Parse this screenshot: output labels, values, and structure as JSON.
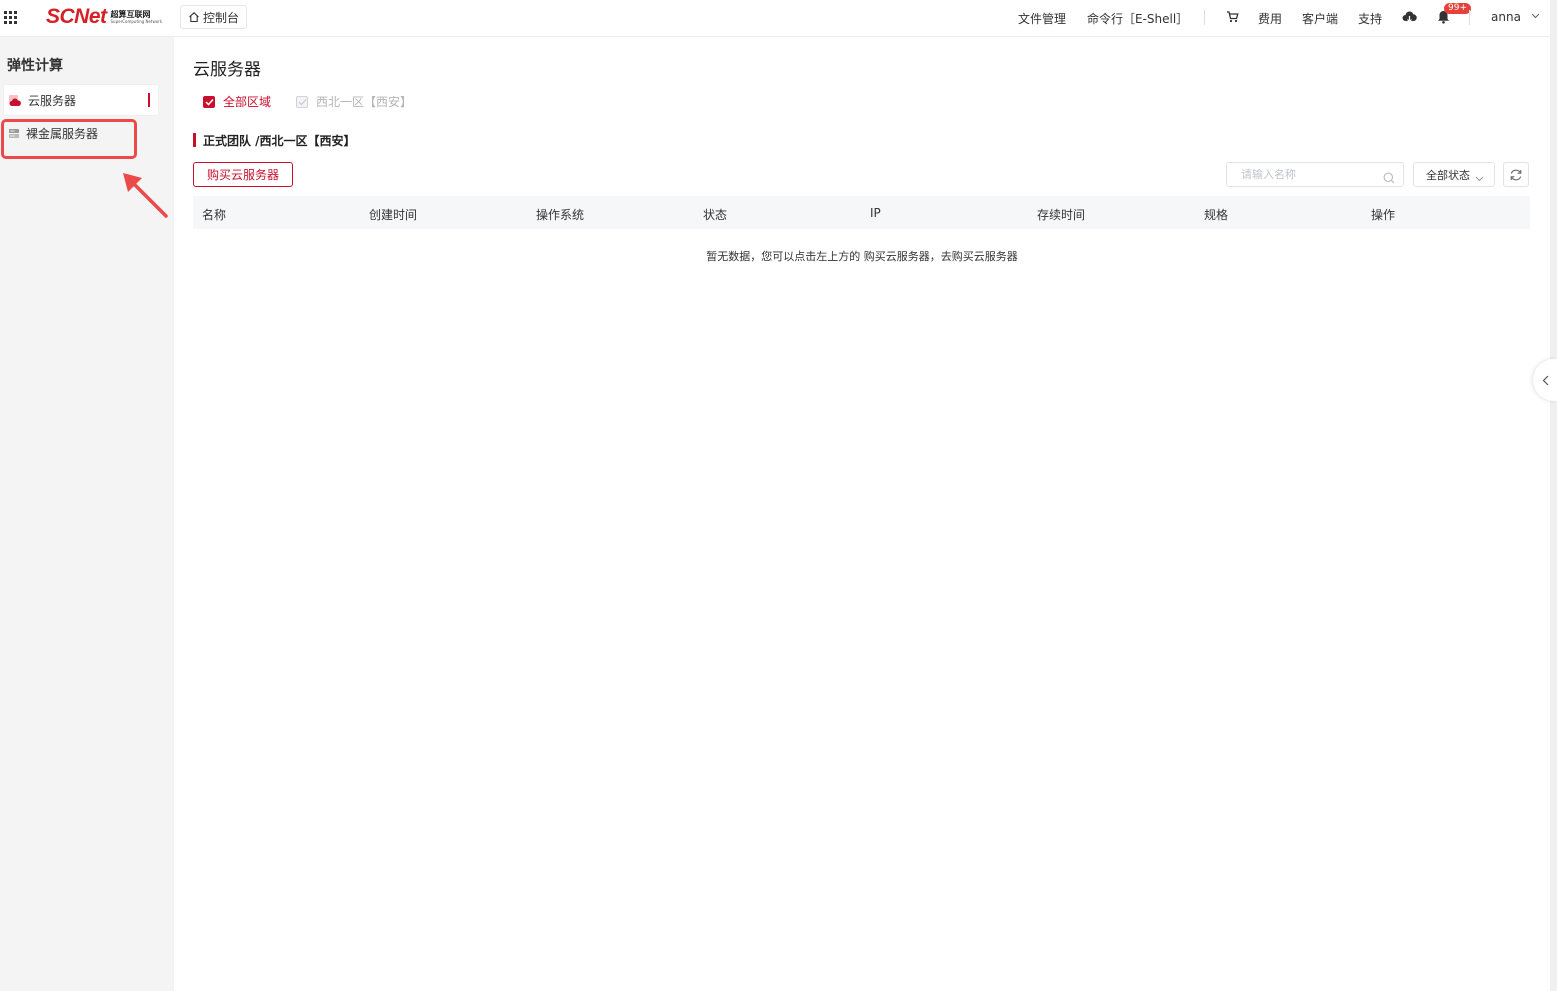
{
  "header": {
    "logo_main": "SCNet",
    "logo_cn": "超算互联网",
    "logo_en": "SuperComputing Network",
    "console_label": "控制台",
    "file_manage": "文件管理",
    "command_line": "命令行［E-Shell］",
    "fees": "费用",
    "client": "客户端",
    "support": "支持",
    "notification_badge": "99+",
    "username": "anna"
  },
  "sidebar": {
    "title": "弹性计算",
    "items": [
      {
        "label": "云服务器",
        "icon": "cloud-server-icon",
        "active": true
      },
      {
        "label": "裸金属服务器",
        "icon": "bare-metal-server-icon",
        "active": false
      }
    ]
  },
  "main": {
    "page_title": "云服务器",
    "regions": [
      {
        "label": "全部区域",
        "checked": true
      },
      {
        "label": "西北一区【西安】",
        "checked": false
      }
    ],
    "section_title": "正式团队 /西北一区【西安】",
    "buy_button": "购买云服务器",
    "search_placeholder": "请输入名称",
    "status_filter": "全部状态",
    "table_headers": [
      "名称",
      "创建时间",
      "操作系统",
      "状态",
      "IP",
      "存续时间",
      "规格",
      "操作"
    ],
    "empty_message": "暂无数据，您可以点击左上方的 购买云服务器，去购买云服务器"
  },
  "colors": {
    "accent": "#c8102e",
    "annotation": "#ec4a4a"
  }
}
